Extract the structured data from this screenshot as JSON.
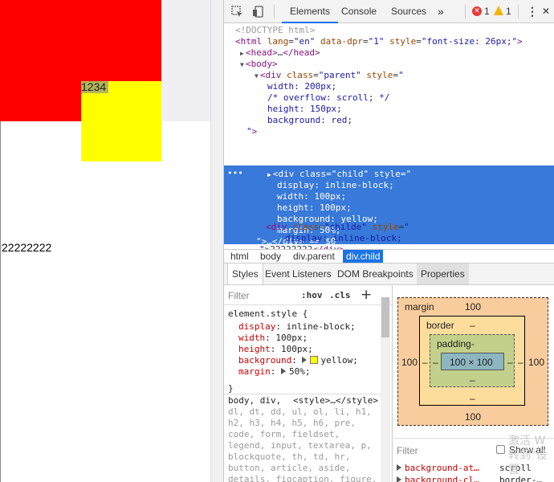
{
  "viewport": {
    "child_text": "1234",
    "text2": "22222222"
  },
  "toolbar": {
    "tabs": [
      "Elements",
      "Console",
      "Sources"
    ],
    "more": "»",
    "errors": "1",
    "warnings": "1",
    "menu": "⋮",
    "close": "✕"
  },
  "tree": [
    {
      "html": "<span class='gray'>&lt;!DOCTYPE html&gt;</span>"
    },
    {
      "html": "<span class='tag'>&lt;html</span> <span class='attr'>lang</span>=<span class='aval'>\"en\"</span> <span class='attr'>data-dpr</span>=<span class='aval'>\"1\"</span> <span class='attr'>style</span>=<span class='aval'>\"font-size: 26px;\"</span><span class='tag'>&gt;</span>"
    },
    {
      "html": "<span class='tag'>&lt;head&gt;</span>…<span class='tag'>&lt;/head&gt;</span>"
    },
    {
      "html": "<span class='tag'>&lt;body&gt;</span>"
    },
    {
      "html": "<span class='tag'>&lt;div</span> <span class='attr'>class</span>=<span class='aval'>\"parent\"</span> <span class='attr'>style</span>=<span class='aval'>\"</span>"
    },
    {
      "html": "<span class='aval'>width: 200px;</span>"
    },
    {
      "html": "<span class='aval'>/* overflow: scroll; */</span>"
    },
    {
      "html": "<span class='aval'>height: 150px;</span>"
    },
    {
      "html": "<span class='aval'>background: red;</span>"
    },
    {
      "html": "<span class='aval'>\"</span><span class='tag'>&gt;</span>"
    },
    {
      "html": "<span class='tag'>&lt;div</span> <span class='attr'>class</span>=<span class='aval'>\"child\"</span> <span class='attr'>style</span>=<span class='aval'>\"</span>"
    },
    {
      "html": "<span class='aval'>display: inline-block;</span>"
    },
    {
      "html": "<span class='aval'>width: 100px;</span>"
    },
    {
      "html": "<span class='aval'>height: 100px;</span>"
    },
    {
      "html": "<span class='aval'>background: yellow;</span>"
    },
    {
      "html": "<span class='aval'>margin: 50%;</span>"
    },
    {
      "html": "<span class='aval'>\"</span><span class='tag'>&gt;</span>…<span class='tag'>&lt;/div&gt;</span> == $0"
    },
    {
      "html": "<span class='tag'>&lt;div</span> <span class='attr'>class</span>=<span class='aval'>\"childe\"</span> <span class='attr'>style</span>=<span class='aval'>\"</span>"
    },
    {
      "html": "<span class='aval'>display: inline-block;</span>"
    },
    {
      "html": "<span class='aval'>\"</span><span class='tag'>&gt;</span>22222222<span class='tag'>&lt;/div&gt;</span>"
    }
  ],
  "crumbs": [
    "html",
    "body",
    "div.parent",
    "div.child"
  ],
  "lower_tabs": [
    "Styles",
    "Event Listeners",
    "DOM Breakpoints",
    "Properties"
  ],
  "styles": {
    "filter_placeholder": "Filter",
    "hov": ":hov",
    "cls": ".cls",
    "plus": "+",
    "selector": "element.style {",
    "rules": [
      {
        "prop": "display",
        "value": "inline-block;"
      },
      {
        "prop": "width",
        "value": "100px;"
      },
      {
        "prop": "height",
        "value": "100px;"
      },
      {
        "prop": "background",
        "value": "yellow;"
      },
      {
        "prop": "margin",
        "value": "50%;"
      }
    ],
    "close": "}",
    "inherited_selectors": "body, div,",
    "inherited_source": "<style>…</style>",
    "ua_lines": [
      "dl, dt, dd, ul, ol, li, h1,",
      "h2, h3, h4, h5, h6, pre,",
      "code, form, fieldset,",
      "legend, input, textarea, p,",
      "blockquote, th, td, hr,",
      "button, article, aside,",
      "details, figcaption, figure,"
    ]
  },
  "boxmodel": {
    "margin_label": "margin",
    "margin_top": "100",
    "margin_bottom": "100",
    "margin_left": "100",
    "margin_right": "100",
    "border_label": "border",
    "border_top": "–",
    "border_bottom": "–",
    "border_left": "–",
    "border_right": "–",
    "padding_label": "padding-",
    "padding_bottom": "–",
    "padding_left": "–",
    "padding_right": "–",
    "content": "100 × 100"
  },
  "computed": {
    "filter_placeholder": "Filter",
    "show_all": "Show all",
    "rows": [
      {
        "prop": "background-at…",
        "value": "scroll"
      },
      {
        "prop": "background-cl…",
        "value": "border-…"
      }
    ]
  },
  "watermark": [
    "激活 W",
    "转到\"设置"
  ],
  "colors": {
    "parent_bg": "#ff0000",
    "child_bg": "#ffff00",
    "selection": "#3879d9",
    "accent": "#1a73e8"
  }
}
